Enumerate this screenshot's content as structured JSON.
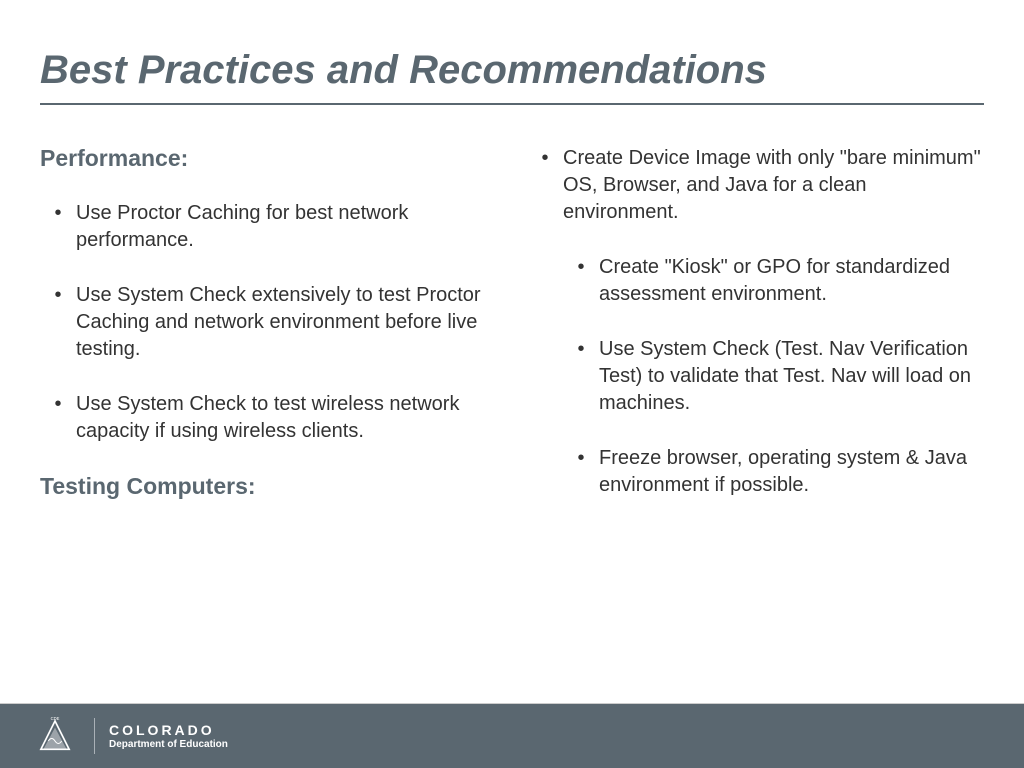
{
  "title": "Best Practices and Recommendations",
  "left": {
    "heading1": "Performance:",
    "bullets": [
      "Use Proctor Caching for best network performance.",
      "Use System Check extensively to test Proctor Caching and network environment before live testing.",
      "Use System Check to test wireless network capacity if using wireless clients."
    ],
    "heading2": "Testing Computers:"
  },
  "right": {
    "main_bullet": "Create Device Image with only \"bare minimum\" OS, Browser, and Java for a clean environment.",
    "nested": [
      "Create \"Kiosk\" or GPO for standardized assessment environment.",
      "Use System Check (Test. Nav Verification Test) to validate that Test. Nav will load on machines.",
      "Freeze browser, operating system & Java environment if possible."
    ]
  },
  "footer": {
    "main": "COLORADO",
    "sub": "Department of Education",
    "badge": "CDE"
  }
}
